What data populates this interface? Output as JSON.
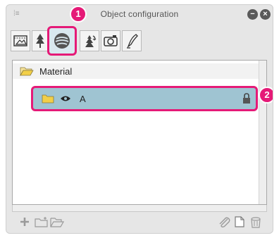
{
  "window": {
    "title": "Object configuration",
    "minimize_symbol": "−",
    "close_symbol": "×"
  },
  "toolbar": {
    "tools": [
      {
        "icon": "image-frame-icon",
        "selected": false
      },
      {
        "icon": "tree-icon",
        "selected": false
      },
      {
        "icon": "material-sphere-icon",
        "selected": true
      },
      {
        "icon": "figure-rotate-icon",
        "selected": false
      },
      {
        "icon": "camera-icon",
        "selected": false
      },
      {
        "icon": "pen-icon",
        "selected": false
      }
    ]
  },
  "callouts": {
    "one": "1",
    "two": "2"
  },
  "tree": {
    "material_label": "Material",
    "item_label": "A"
  },
  "colors": {
    "highlight": "#e51a77",
    "selected_row": "#9fc4d2",
    "folder": "#f2cf48"
  }
}
